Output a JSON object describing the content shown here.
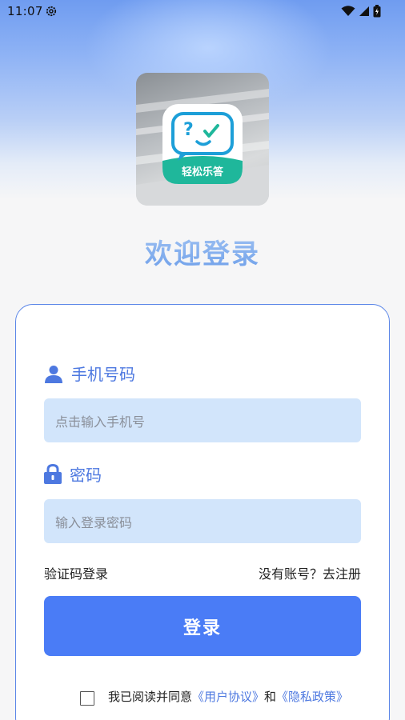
{
  "status_bar": {
    "time": "11:07"
  },
  "app": {
    "logo_text": "轻松乐答"
  },
  "welcome_title": "欢迎登录",
  "phone": {
    "label": "手机号码",
    "placeholder": "点击输入手机号"
  },
  "password": {
    "label": "密码",
    "placeholder": "输入登录密码"
  },
  "links": {
    "sms_login": "验证码登录",
    "register": "没有账号？去注册"
  },
  "login_button": "登录",
  "agreement": {
    "prefix": "我已阅读并同意",
    "user_agreement": "《用户协议》",
    "conjunction": "和",
    "privacy_policy": "《隐私政策》",
    "checked": false
  },
  "colors": {
    "accent": "#4a7cf6",
    "label": "#4d78e0",
    "input_bg": "#d2e5fb",
    "card_border": "#5b86e8"
  }
}
